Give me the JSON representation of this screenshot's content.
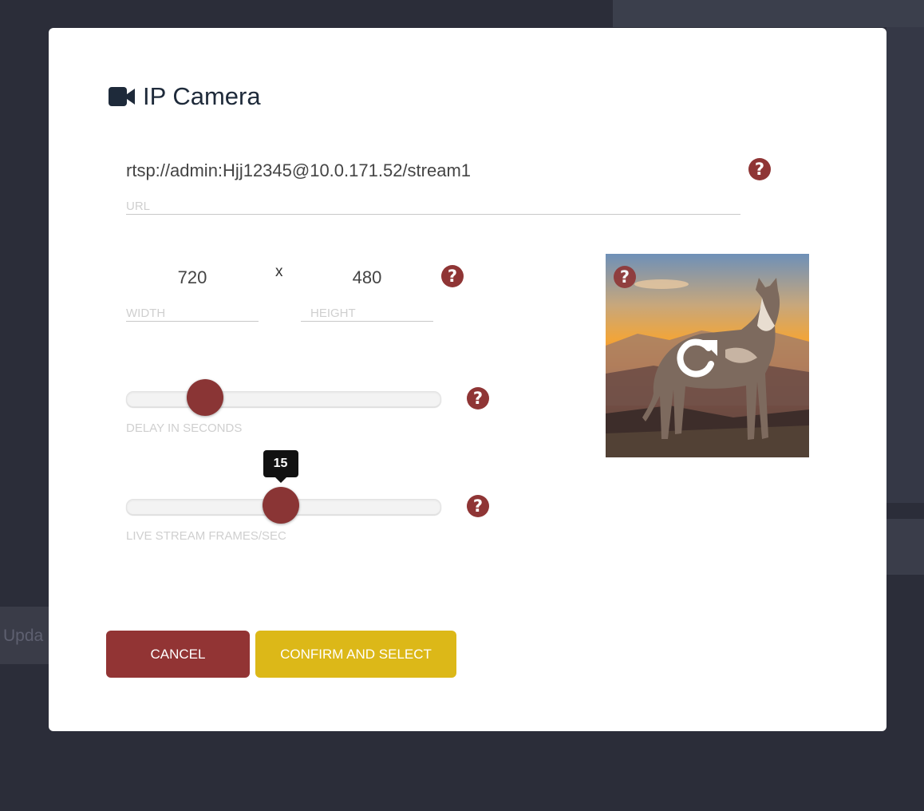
{
  "background": {
    "left_text": "Upda"
  },
  "dialog": {
    "title": "IP Camera",
    "title_icon": "video-camera-icon"
  },
  "url": {
    "value": "rtsp://admin:Hjj12345@10.0.171.52/stream1",
    "label": "URL"
  },
  "size": {
    "width_value": "720",
    "height_value": "480",
    "separator": "x",
    "width_label": "WIDTH",
    "height_label": "HEIGHT"
  },
  "delay": {
    "label": "DELAY IN SECONDS",
    "fraction": 0.25
  },
  "fps": {
    "label": "LIVE STREAM FRAMES/SEC",
    "value": "15",
    "fraction": 0.49
  },
  "help_glyph": "?",
  "buttons": {
    "cancel": "CANCEL",
    "confirm": "CONFIRM AND SELECT"
  },
  "colors": {
    "accent_red": "#8f3535",
    "confirm_yellow": "#dcb818",
    "title": "#1e2a3a"
  }
}
